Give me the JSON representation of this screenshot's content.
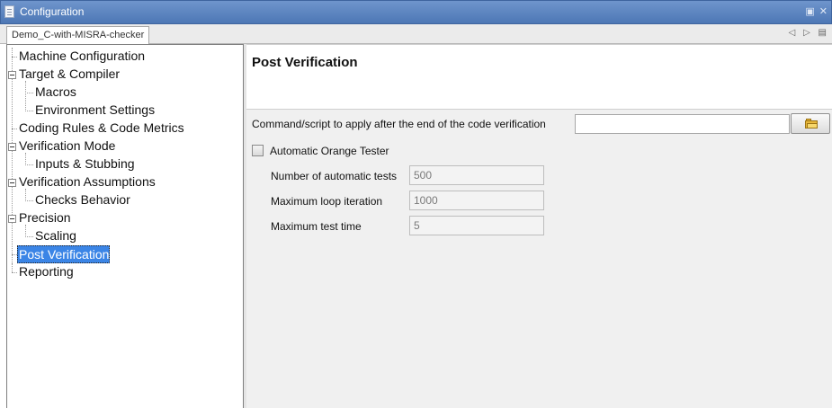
{
  "window": {
    "title": "Configuration",
    "controls": [
      "▣",
      "✕"
    ]
  },
  "tab": {
    "label": "Demo_C-with-MISRA-checker",
    "nav": [
      "◁",
      "▷",
      "▤"
    ]
  },
  "tree": {
    "items": [
      {
        "label": "Machine Configuration",
        "selected": false
      },
      {
        "label": "Target & Compiler",
        "selected": false
      },
      {
        "label": "Macros",
        "selected": false
      },
      {
        "label": "Environment Settings",
        "selected": false
      },
      {
        "label": "Coding Rules & Code Metrics",
        "selected": false
      },
      {
        "label": "Verification Mode",
        "selected": false
      },
      {
        "label": "Inputs & Stubbing",
        "selected": false
      },
      {
        "label": "Verification Assumptions",
        "selected": false
      },
      {
        "label": "Checks Behavior",
        "selected": false
      },
      {
        "label": "Precision",
        "selected": false
      },
      {
        "label": "Scaling",
        "selected": false
      },
      {
        "label": "Post Verification",
        "selected": true
      },
      {
        "label": "Reporting",
        "selected": false
      }
    ],
    "selection_color": "#3b85e6"
  },
  "page": {
    "title": "Post Verification",
    "command_label": "Command/script to apply after the end of the code verification",
    "command_value": "",
    "browse_icon": "folder-icon",
    "orange_tester_label": "Automatic Orange Tester",
    "orange_tester_checked": false,
    "fields": [
      {
        "label": "Number of automatic tests",
        "value": "500"
      },
      {
        "label": "Maximum loop iteration",
        "value": "1000"
      },
      {
        "label": "Maximum test time",
        "value": "5"
      }
    ]
  }
}
